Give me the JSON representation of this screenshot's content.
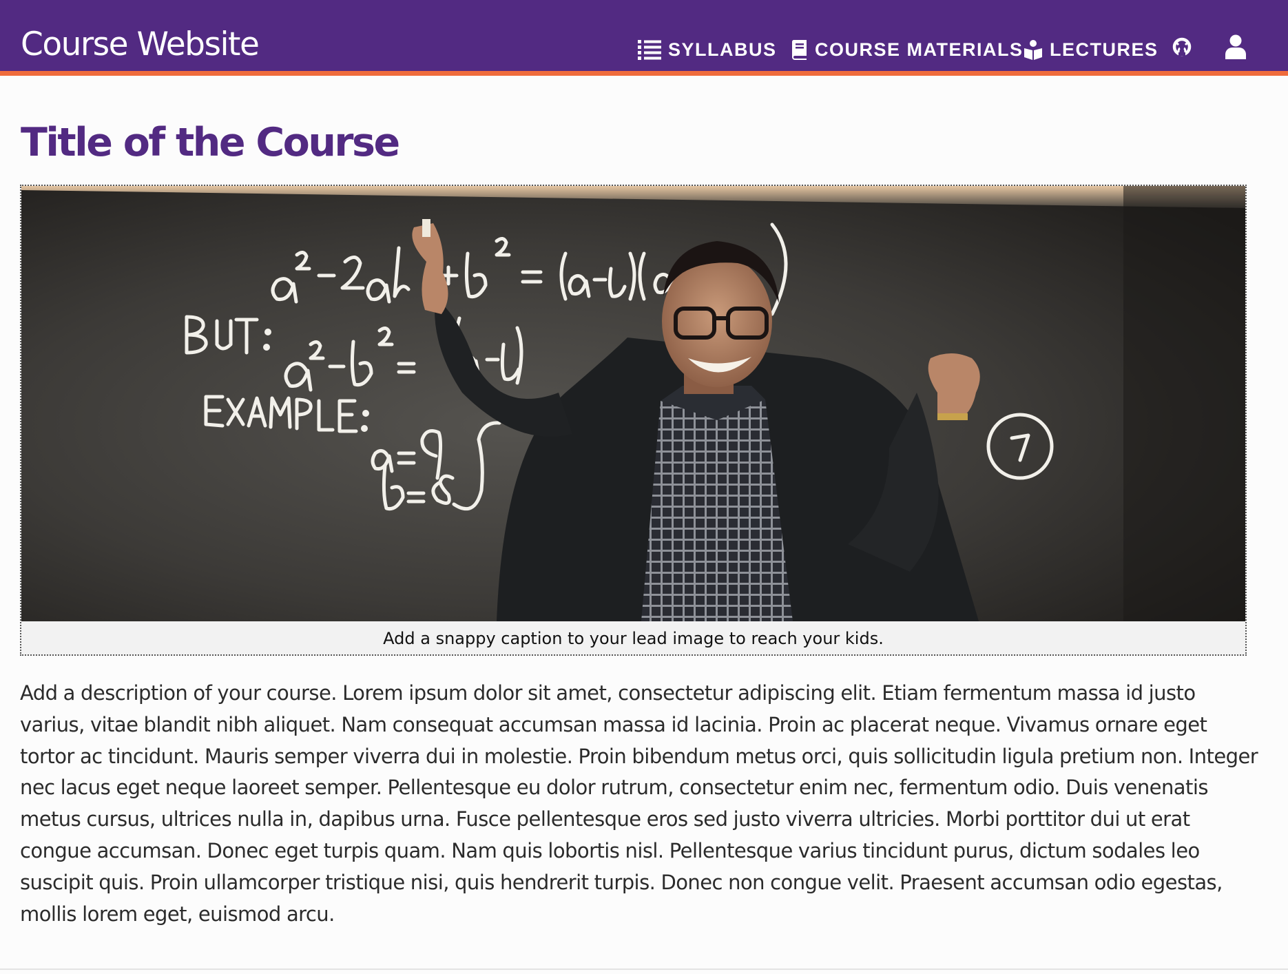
{
  "header": {
    "brand": "Course Website",
    "nav": [
      {
        "label": "SYLLABUS",
        "icon": "list-icon"
      },
      {
        "label": "COURSE MATERIALS",
        "icon": "book-icon"
      },
      {
        "label": "LECTURES",
        "icon": "reader-icon"
      }
    ],
    "icons": [
      "github-icon",
      "user-icon"
    ],
    "colors": {
      "bar": "#522a82",
      "accent": "#ef6c3c"
    }
  },
  "main": {
    "title": "Title of the Course",
    "lead_image": {
      "caption": "Add a snappy caption to your lead image to reach your kids.",
      "chalkboard_text": {
        "line1": "a² − 2ab + b² = (a−b)(a−b)",
        "but": "BUT:",
        "line2": "a² − b² = (a−b)(a−b)",
        "example": "EXAMPLE:",
        "a_value": "a = 9",
        "b_value": "b = 8",
        "circled": "7"
      }
    },
    "description": "Add a description of your course. Lorem ipsum dolor sit amet, consectetur adipiscing elit. Etiam fermentum massa id justo varius, vitae blandit nibh aliquet. Nam consequat accumsan massa id lacinia. Proin ac placerat neque. Vivamus ornare eget tortor ac tincidunt. Mauris semper viverra dui in molestie. Proin bibendum metus orci, quis sollicitudin ligula pretium non. Integer nec lacus eget neque laoreet semper. Pellentesque eu dolor rutrum, consectetur enim nec, fermentum odio. Duis venenatis metus cursus, ultrices nulla in, dapibus urna. Fusce pellentesque eros sed justo viverra ultricies. Morbi porttitor dui ut erat congue accumsan. Donec eget turpis quam. Nam quis lobortis nisl. Pellentesque varius tincidunt purus, dictum sodales leo suscipit quis. Proin ullamcorper tristique nisi, quis hendrerit turpis. Donec non congue velit. Praesent accumsan odio egestas, mollis lorem eget, euismod arcu."
  }
}
